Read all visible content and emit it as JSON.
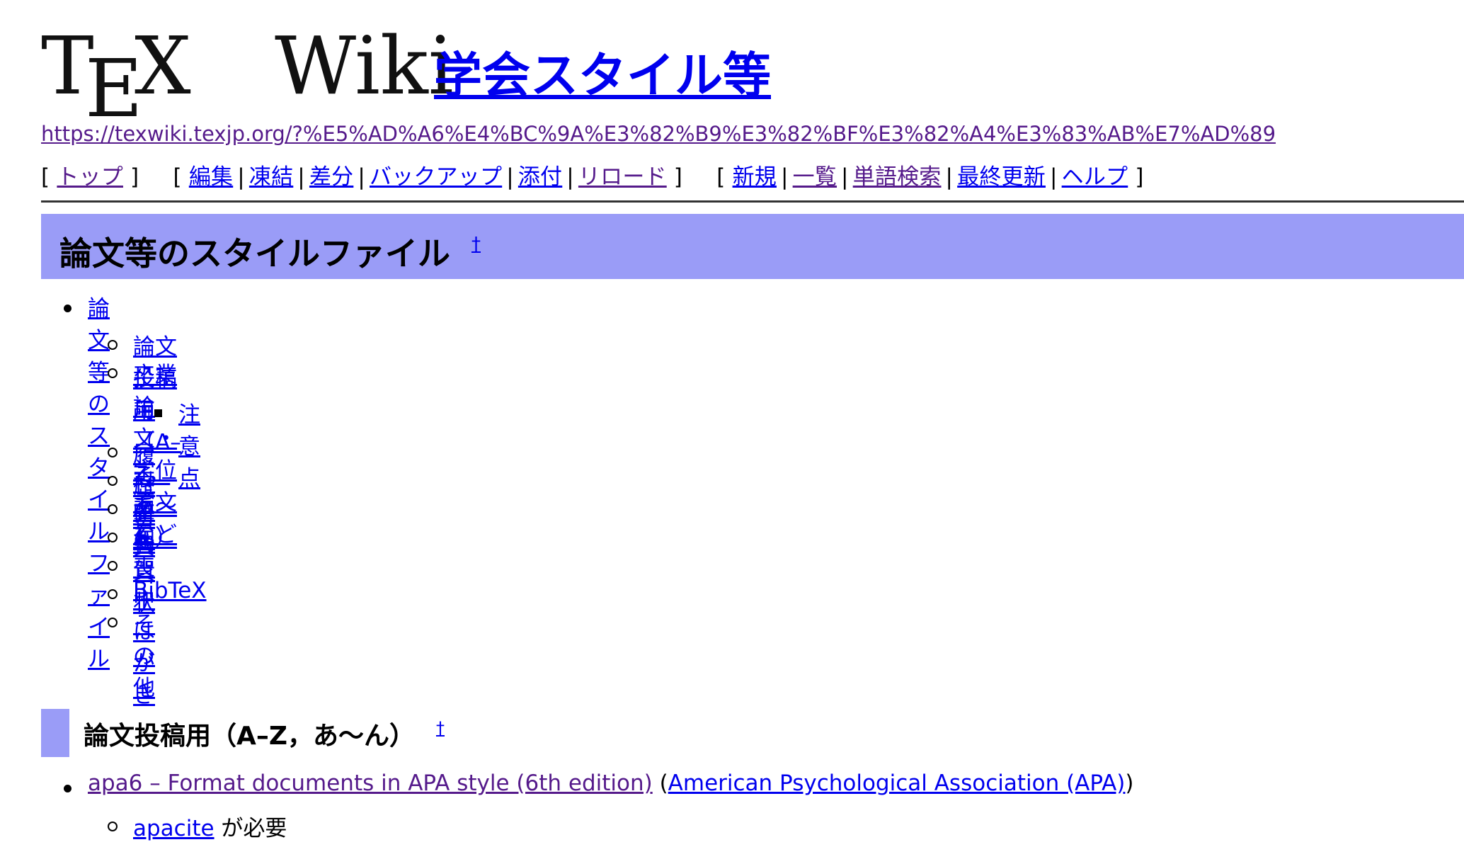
{
  "logo": {
    "t": "T",
    "e": "E",
    "x": "X",
    "wiki": "Wiki"
  },
  "page_title": "学会スタイル等",
  "page_url": "https://texwiki.texjp.org/?%E5%AD%A6%E4%BC%9A%E3%82%B9%E3%82%BF%E3%82%A4%E3%83%AB%E7%AD%89",
  "navbar": {
    "group1": [
      "トップ"
    ],
    "group2": [
      "編集",
      "凍結",
      "差分",
      "バックアップ",
      "添付",
      "リロード"
    ],
    "group3": [
      "新規",
      "一覧",
      "単語検索",
      "最終更新",
      "ヘルプ"
    ],
    "open_bracket": "[",
    "close_bracket": "]",
    "separator": "|"
  },
  "section_heading": {
    "title": "論文等のスタイルファイル",
    "anchor": "†"
  },
  "toc": {
    "root": "論文等のスタイルファイル",
    "items": [
      "論文投稿用（A–Z，あ〜ん）",
      "卒業論文・学位論文など",
      "注意点",
      "履歴書",
      "科研費",
      "名刺",
      "年賀状",
      "喪中はがき",
      "BibTeX",
      "その他"
    ]
  },
  "subsection_heading": {
    "title": "論文投稿用（A–Z，あ〜ん）",
    "anchor": "†"
  },
  "entries": {
    "first_link": "apa6 – Format documents in APA style (6th edition)",
    "paren_open": " (",
    "second_link": "American Psychological Association (APA)",
    "paren_close": ")",
    "sub_link": "apacite",
    "sub_text": " が必要"
  },
  "colors": {
    "link": "#0000ee",
    "visited": "#551a8b",
    "heading_bg": "#9a9cf7"
  }
}
